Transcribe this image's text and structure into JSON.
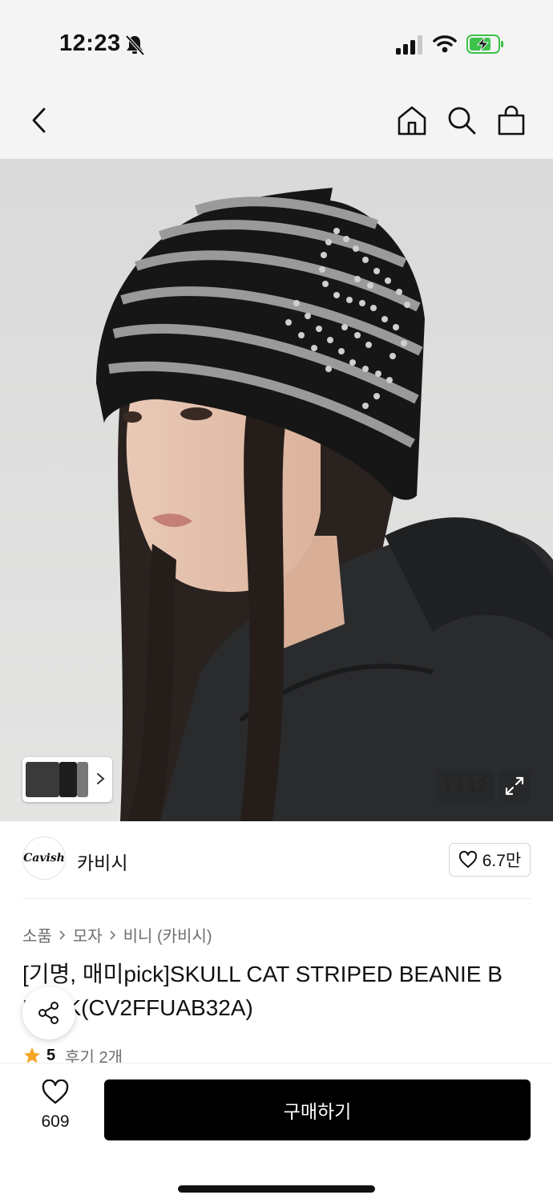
{
  "status_bar": {
    "time": "12:23",
    "icons": [
      "bell-slash-icon",
      "cellular-signal-icon",
      "wifi-icon",
      "battery-charging-icon"
    ]
  },
  "nav": {
    "icons": [
      "back-chevron-icon",
      "home-icon",
      "search-icon",
      "shopping-bag-icon"
    ]
  },
  "gallery": {
    "counter": "1 / 12",
    "icons": [
      "expand-icon",
      "chevron-right-icon"
    ]
  },
  "brand": {
    "logo_text": "Cavish",
    "name": "카비시",
    "likes": "6.7만"
  },
  "breadcrumb": [
    "소품",
    "모자",
    "비니 (카비시)"
  ],
  "product": {
    "title_line1": "[기명, 매미pick]SKULL CAT STRIPED BEANIE B",
    "title_line2": "LACK(CV2FFUAB32A)",
    "rating": "5",
    "reviews": "후기 2개"
  },
  "bottom": {
    "wish_count": "609",
    "buy_label": "구매하기"
  },
  "colors": {
    "status_bg": "#f4f4f4",
    "battery_green": "#3dc24c",
    "star": "#f5a623",
    "buy_bg": "#000000"
  }
}
